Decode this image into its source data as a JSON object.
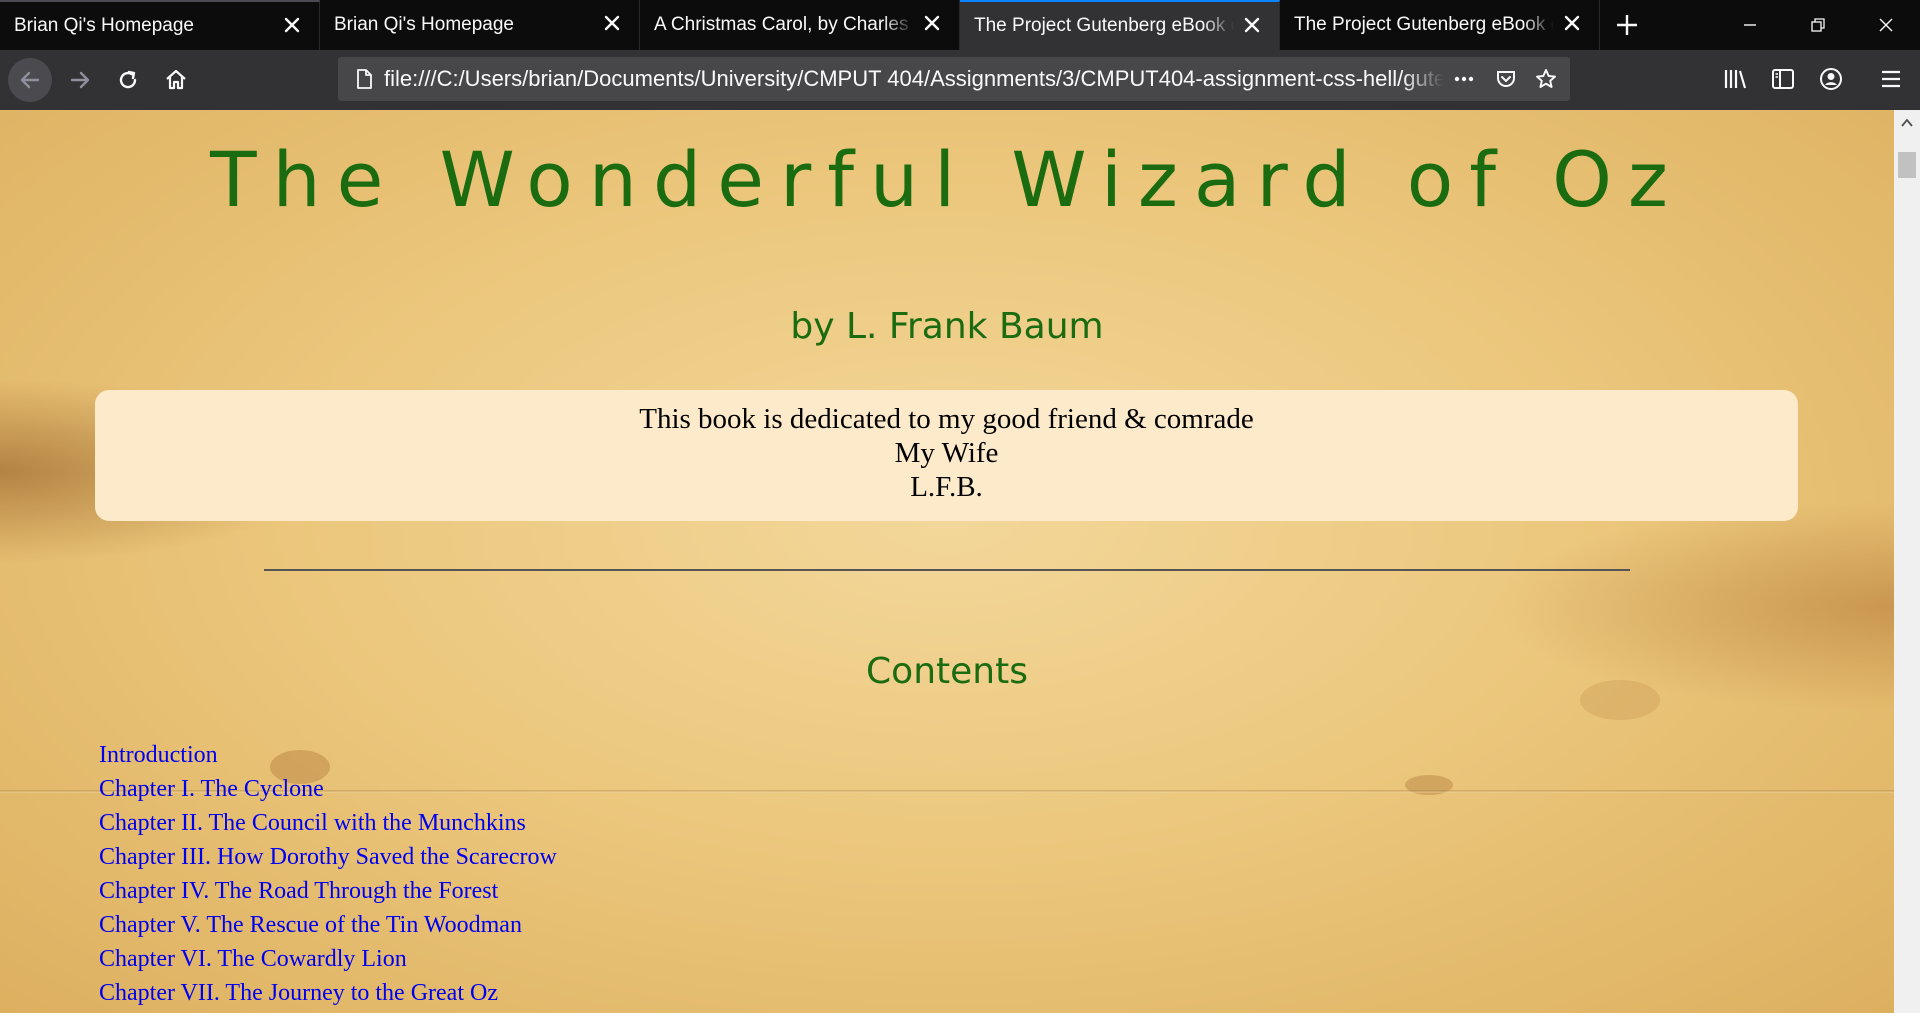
{
  "tabs": [
    {
      "label": "Brian Qi's Homepage"
    },
    {
      "label": "Brian Qi's Homepage"
    },
    {
      "label": "A Christmas Carol, by Charles Dickens"
    },
    {
      "label": "The Project Gutenberg eBook of The Wonderful Wizard of Oz"
    },
    {
      "label": "The Project Gutenberg eBook of The Wonderful Wizard of Oz"
    }
  ],
  "address_bar": {
    "url": "file:///C:/Users/brian/Documents/University/CMPUT 404/Assignments/3/CMPUT404-assignment-css-hell/gutenberg/oz.html"
  },
  "icons": {
    "page": "page-icon",
    "back": "back-arrow-icon",
    "forward": "forward-arrow-icon",
    "reload": "reload-icon",
    "home": "home-icon",
    "menu": "hamburger-menu-icon"
  },
  "colors": {
    "heading_green": "#1b6b10",
    "link_blue": "#0000ee",
    "dedication_bg": "#fdeacb",
    "active_tab_accent": "#0a84ff"
  },
  "page": {
    "title": "The Wonderful Wizard of Oz",
    "author": "by L. Frank Baum",
    "dedication": {
      "line1": "This book is dedicated to my good friend & comrade",
      "line2": "My Wife",
      "line3": "L.F.B."
    },
    "contents_heading": "Contents",
    "toc": [
      "Introduction",
      "Chapter I. The Cyclone",
      "Chapter II. The Council with the Munchkins",
      "Chapter III. How Dorothy Saved the Scarecrow",
      "Chapter IV. The Road Through the Forest",
      "Chapter V. The Rescue of the Tin Woodman",
      "Chapter VI. The Cowardly Lion",
      "Chapter VII. The Journey to the Great Oz"
    ]
  }
}
